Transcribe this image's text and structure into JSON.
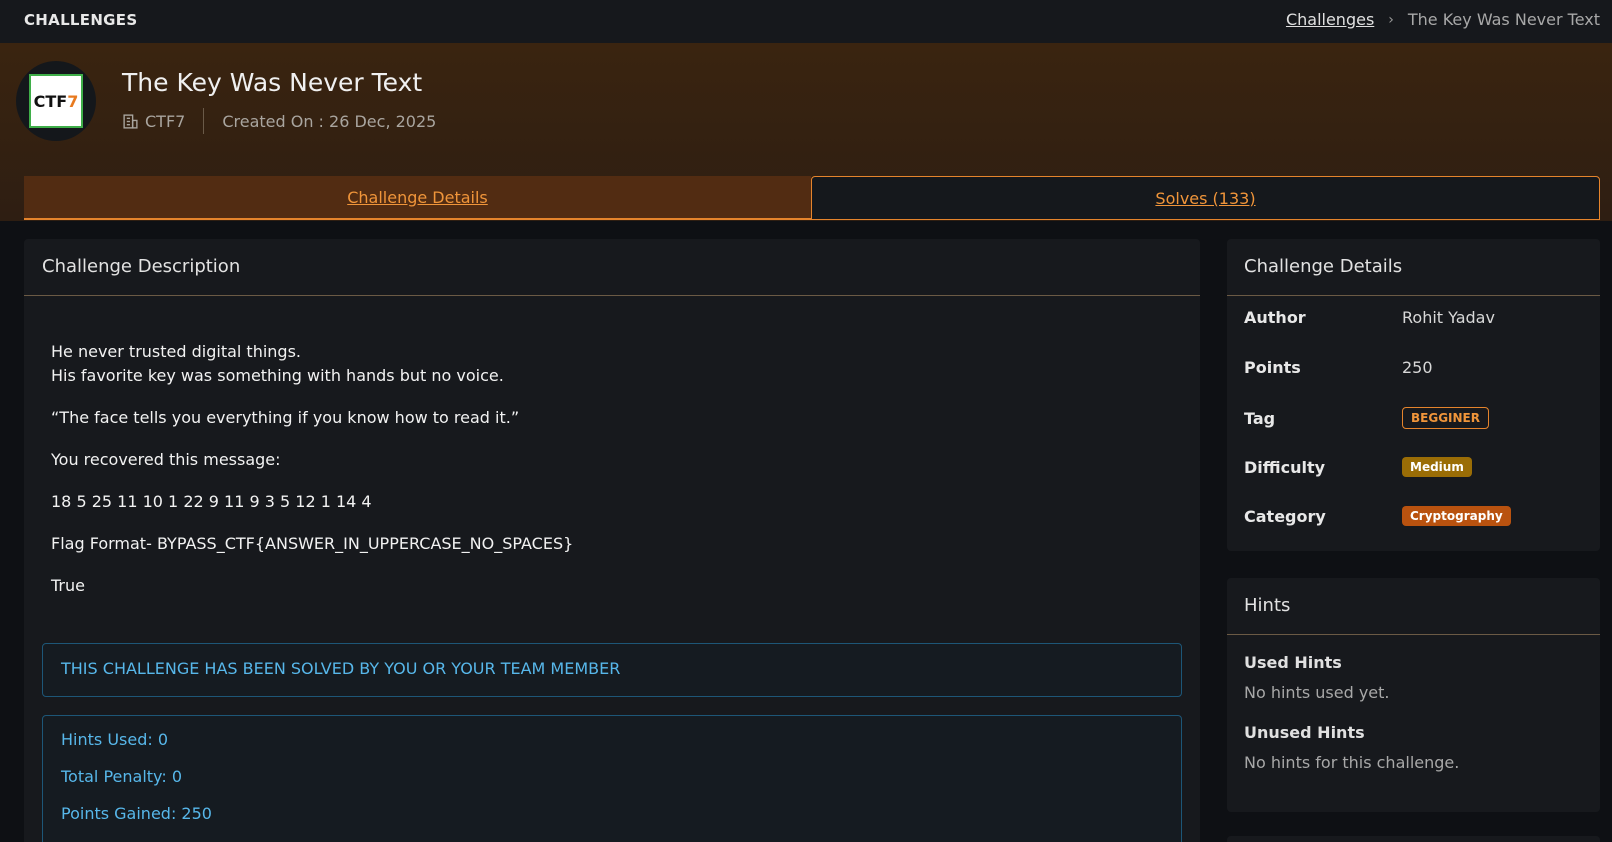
{
  "topbar": {
    "brand": "CHALLENGES",
    "breadcrumb_link": "Challenges",
    "breadcrumb_separator": "›",
    "breadcrumb_current": "The Key Was Never Text"
  },
  "hero": {
    "logo_text": "CTF",
    "logo_accent": "7",
    "title": "The Key Was Never Text",
    "org": "CTF7",
    "created": "Created On : 26 Dec, 2025"
  },
  "tabs": [
    {
      "label": "Challenge Details",
      "active": true
    },
    {
      "label": "Solves (133)",
      "active": false
    }
  ],
  "description": {
    "heading": "Challenge Description",
    "line1": "He never trusted digital things.",
    "line2": "His favorite key was something with hands but no voice.",
    "quote": "“The face tells you everything if you know how to read it.”",
    "recovered": "You recovered this message:",
    "cipher": "18 5 25 11 10 1 22 9 11 9 3 5 12 1 14 4",
    "flag_format": "Flag Format- BYPASS_CTF{ANSWER_IN_UPPERCASE_NO_SPACES}",
    "extra": "True",
    "solved_notice": "THIS CHALLENGE HAS BEEN SOLVED BY YOU OR YOUR TEAM MEMBER",
    "hints_used": "Hints Used: 0",
    "total_penalty": "Total Penalty: 0",
    "points_gained": "Points Gained: 250"
  },
  "details": {
    "heading": "Challenge Details",
    "author_label": "Author",
    "author": "Rohit Yadav",
    "points_label": "Points",
    "points": "250",
    "tag_label": "Tag",
    "tag": "BEGGINER",
    "difficulty_label": "Difficulty",
    "difficulty": "Medium",
    "category_label": "Category",
    "category": "Cryptography"
  },
  "hints": {
    "heading": "Hints",
    "used_label": "Used Hints",
    "used_note": "No hints used yet.",
    "unused_label": "Unused Hints",
    "unused_note": "No hints for this challenge."
  },
  "colors": {
    "accent": "#e5842c",
    "info": "#57b7ea",
    "medium_badge": "#9a6d06",
    "category_badge": "#b9520f"
  }
}
